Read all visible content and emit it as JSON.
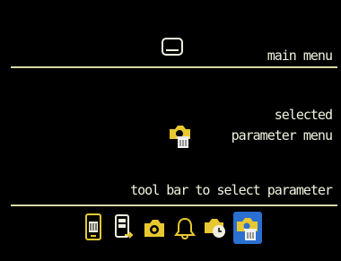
{
  "main_menu": {
    "label": "main menu",
    "icon": "screen-icon"
  },
  "parameter_menu": {
    "label_line1": "selected",
    "label_line2": "parameter menu",
    "icon": "camera-delete-icon"
  },
  "toolbar": {
    "label": "tool bar to select parameter",
    "items": [
      {
        "icon": "phone-delete-icon"
      },
      {
        "icon": "export-icon"
      },
      {
        "icon": "camera-icon"
      },
      {
        "icon": "bell-icon"
      },
      {
        "icon": "camera-timer-icon"
      },
      {
        "icon": "camera-delete-icon",
        "selected": true
      }
    ]
  },
  "colors": {
    "background": "#000000",
    "accent": "#e8c830",
    "rule": "#d8d8a8",
    "selected": "#2b6fd1",
    "text": "#f2f2e0"
  }
}
